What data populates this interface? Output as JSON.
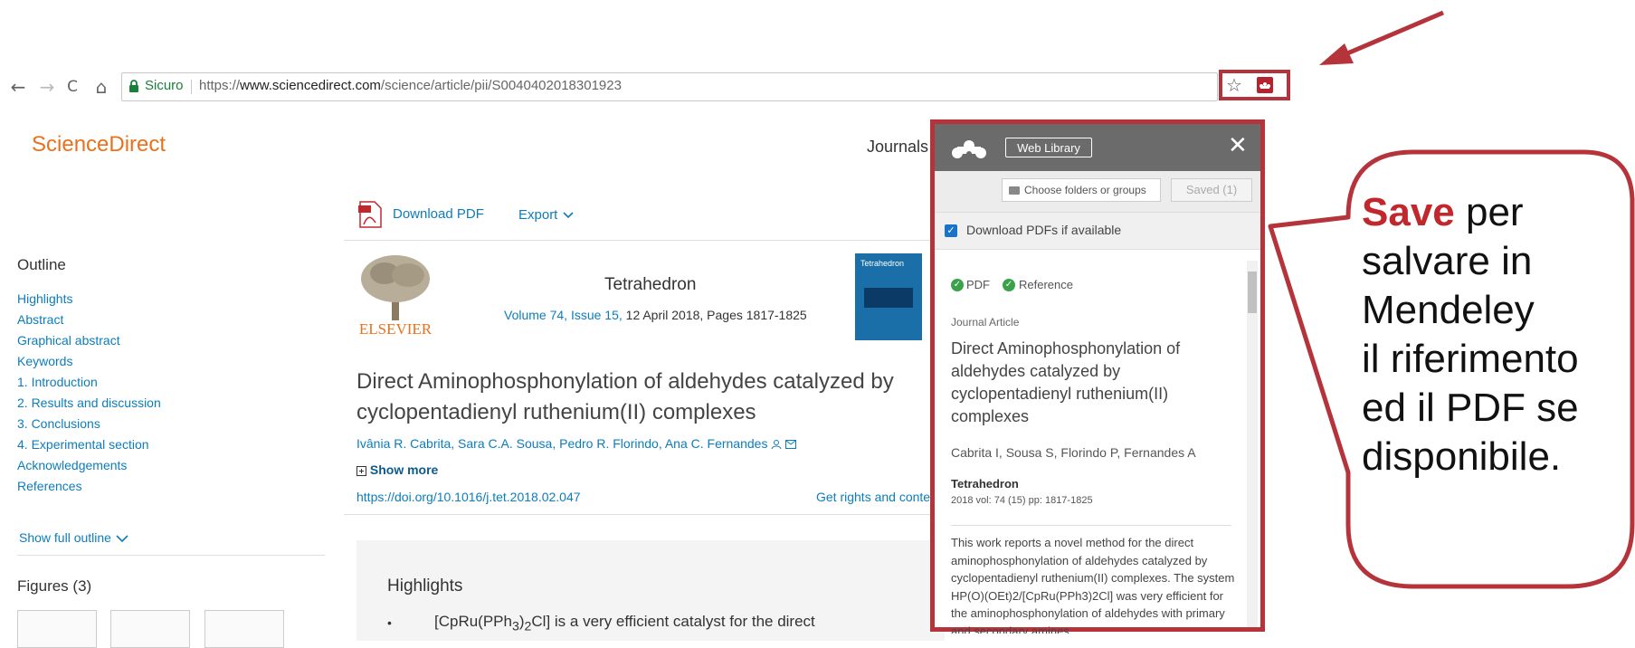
{
  "browser": {
    "secure_label": "Sicuro",
    "url_scheme": "https://",
    "url_host": "www.sciencedirect.com",
    "url_path": "/science/article/pii/S0040402018301923",
    "back_icon": "←",
    "forward_icon": "→",
    "reload_icon": "C",
    "home_icon": "⌂",
    "star_icon": "☆"
  },
  "site": {
    "logo": "ScienceDirect",
    "journals": "Journals",
    "download_pdf": "Download PDF",
    "export": "Export"
  },
  "outline": {
    "title": "Outline",
    "items": [
      "Highlights",
      "Abstract",
      "Graphical abstract",
      "Keywords",
      "1. Introduction",
      "2. Results and discussion",
      "3. Conclusions",
      "4. Experimental section",
      "Acknowledgements",
      "References"
    ],
    "show_full": "Show full outline",
    "figures_title": "Figures (3)"
  },
  "article": {
    "publisher_logo": "ELSEVIER",
    "journal": "Tetrahedron",
    "volume_link": "Volume 74, Issue 15,",
    "volume_rest": " 12 April 2018, Pages 1817-1825",
    "cover_text": "Tetrahedron",
    "title": "Direct Aminophosphonylation of aldehydes catalyzed by cyclopentadienyl ruthenium(II) complexes",
    "authors": "Ivânia R. Cabrita, Sara C.A. Sousa, Pedro R. Florindo, Ana C. Fernandes",
    "show_more": "Show more",
    "doi": "https://doi.org/10.1016/j.tet.2018.02.047",
    "rights": "Get rights and conte",
    "highlights_title": "Highlights",
    "bullet": "•",
    "hl_a": "[CpRu(PPh",
    "hl_sub1": "3",
    "hl_b": ")",
    "hl_sub2": "2",
    "hl_c": "Cl] is a very efficient catalyst for the direct"
  },
  "mendeley": {
    "web_library": "Web Library",
    "close": "✕",
    "choose_folders": "Choose folders or groups",
    "saved": "Saved (1)",
    "download_pdfs": "Download PDFs if available",
    "pdf_label": "PDF",
    "reference_label": "Reference",
    "doc_type": "Journal Article",
    "title": "Direct Aminophosphonylation of aldehydes catalyzed by cyclopentadienyl ruthenium(II) complexes",
    "authors": "Cabrita I,  Sousa S,  Florindo P,  Fernandes A",
    "journal": "Tetrahedron",
    "meta": "2018 vol: 74 (15) pp: 1817-1825",
    "abstract": "This work reports a novel method for the direct aminophosphonylation of aldehydes catalyzed by cyclopentadienyl ruthenium(II) complexes. The system HP(O)(OEt)2/[CpRu(PPh3)2Cl] was very efficient for the aminophosphonylation of aldehydes with primary and secondary amines,"
  },
  "callout": {
    "save": "Save",
    "line1_rest": " per",
    "line2": "salvare in",
    "line3": "Mendeley",
    "line4": "il riferimento",
    "line5": "ed il PDF se",
    "line6": "disponibile."
  },
  "colors": {
    "annotation_red": "#b5343c",
    "link_blue": "#0c7dbb",
    "sciencedirect_orange": "#e9711c",
    "mendeley_header": "#6b6b6b"
  }
}
